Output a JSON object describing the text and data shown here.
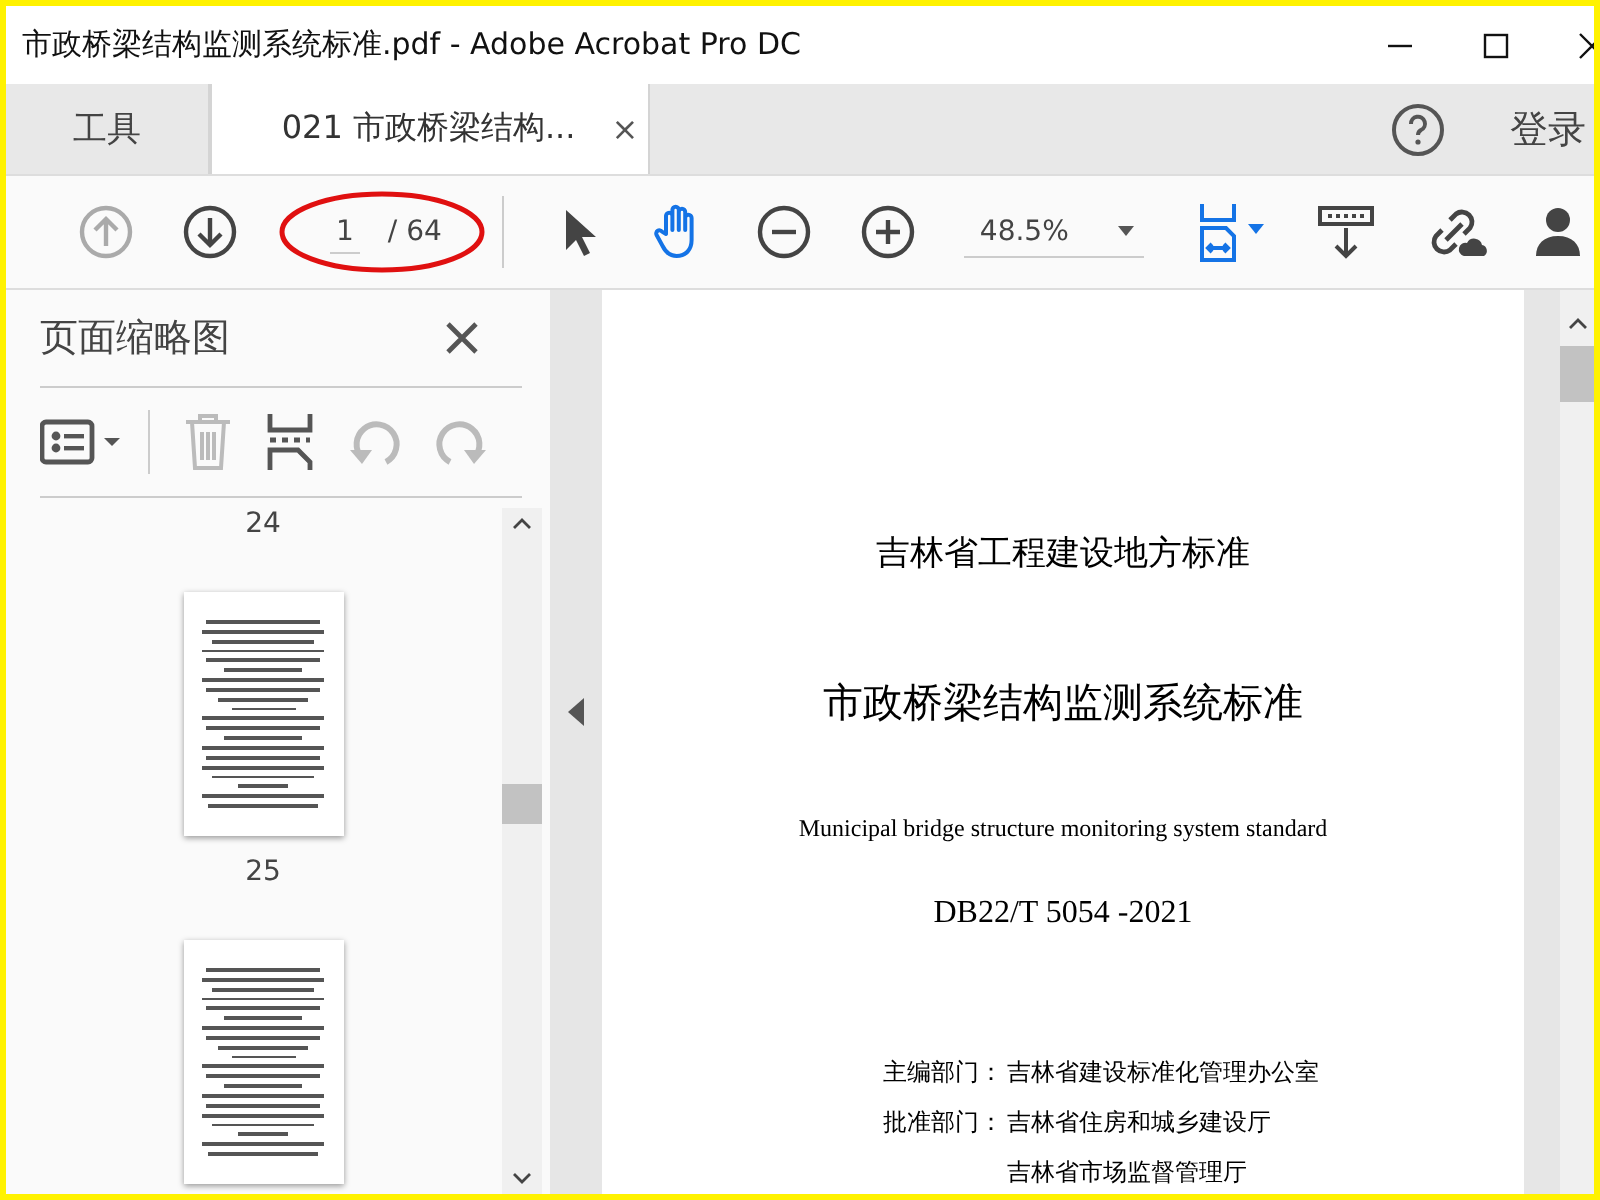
{
  "window": {
    "title": "市政桥梁结构监测系统标准.pdf - Adobe Acrobat Pro DC"
  },
  "tabs": [
    {
      "label": "工具",
      "selected": false
    },
    {
      "label": "021 市政桥梁结构...",
      "selected": true,
      "close": "×"
    }
  ],
  "header": {
    "login": "登录"
  },
  "toolbar": {
    "tools": [
      {
        "kind": "up",
        "disabled": true
      },
      {
        "kind": "down",
        "disabled": false
      }
    ],
    "page_current": "1",
    "page_total": "/ 64",
    "modes": [
      {
        "kind": "pointer",
        "selected": false
      },
      {
        "kind": "hand",
        "selected": true
      }
    ],
    "zoom": "48.5%"
  },
  "sidebar": {
    "title": "页面缩略图",
    "tools": [
      {
        "kind": "options",
        "disabled": false
      },
      {
        "kind": "delete",
        "disabled": true
      },
      {
        "kind": "insert",
        "disabled": false
      },
      {
        "kind": "undo",
        "disabled": true
      },
      {
        "kind": "redo",
        "disabled": true
      }
    ],
    "items": [
      {
        "kind": "label",
        "text": "24"
      },
      {
        "kind": "page"
      },
      {
        "kind": "label",
        "text": "25"
      },
      {
        "kind": "page"
      }
    ]
  },
  "document": {
    "lines": [
      {
        "kind": "heading",
        "text": "吉林省工程建设地方标准"
      },
      {
        "kind": "title",
        "text": "市政桥梁结构监测系统标准"
      },
      {
        "kind": "english",
        "text": "Municipal bridge structure monitoring system standard"
      },
      {
        "kind": "code",
        "text": "DB22/T 5054 -2021"
      },
      {
        "kind": "meta",
        "label": "主编部门：",
        "text": "吉林省建设标准化管理办公室"
      },
      {
        "kind": "meta",
        "label": "批准部门：",
        "text": "吉林省住房和城乡建设厅"
      },
      {
        "kind": "meta",
        "text": "吉林省市场监督管理厅"
      }
    ]
  }
}
